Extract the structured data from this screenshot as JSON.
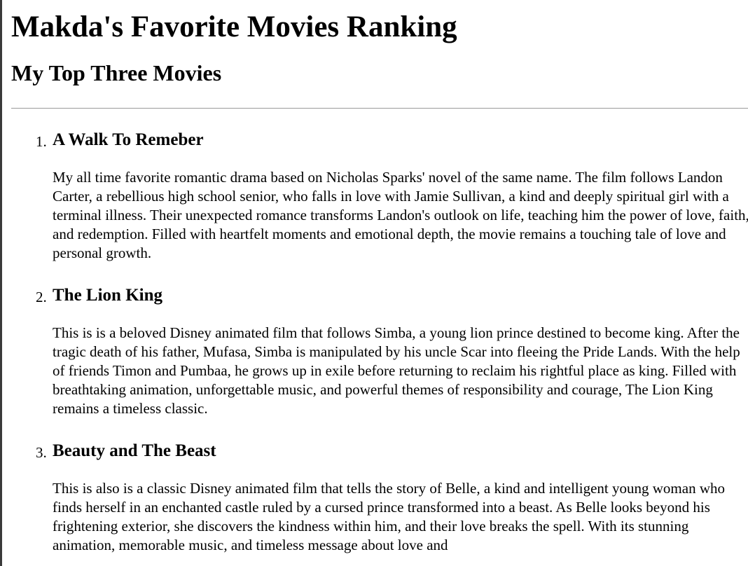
{
  "page": {
    "title": "Makda's Favorite Movies Ranking",
    "subtitle": "My Top Three Movies"
  },
  "movies": [
    {
      "number": "1.",
      "title": "A Walk To Remeber",
      "description": "My all time favorite romantic drama based on Nicholas Sparks' novel of the same name. The film follows Landon Carter, a rebellious high school senior, who falls in love with Jamie Sullivan, a kind and deeply spiritual girl with a terminal illness. Their unexpected romance transforms Landon's outlook on life, teaching him the power of love, faith, and redemption. Filled with heartfelt moments and emotional depth, the movie remains a touching tale of love and personal growth."
    },
    {
      "number": "2.",
      "title": "The Lion King",
      "description": "This is is a beloved Disney animated film that follows Simba, a young lion prince destined to become king. After the tragic death of his father, Mufasa, Simba is manipulated by his uncle Scar into fleeing the Pride Lands. With the help of friends Timon and Pumbaa, he grows up in exile before returning to reclaim his rightful place as king. Filled with breathtaking animation, unforgettable music, and powerful themes of responsibility and courage, The Lion King remains a timeless classic."
    },
    {
      "number": "3.",
      "title": "Beauty and The Beast",
      "description": "This is also is a classic Disney animated film that tells the story of Belle, a kind and intelligent young woman who finds herself in an enchanted castle ruled by a cursed prince transformed into a beast. As Belle looks beyond his frightening exterior, she discovers the kindness within him, and their love breaks the spell. With its stunning animation, memorable music, and timeless message about love and"
    }
  ]
}
